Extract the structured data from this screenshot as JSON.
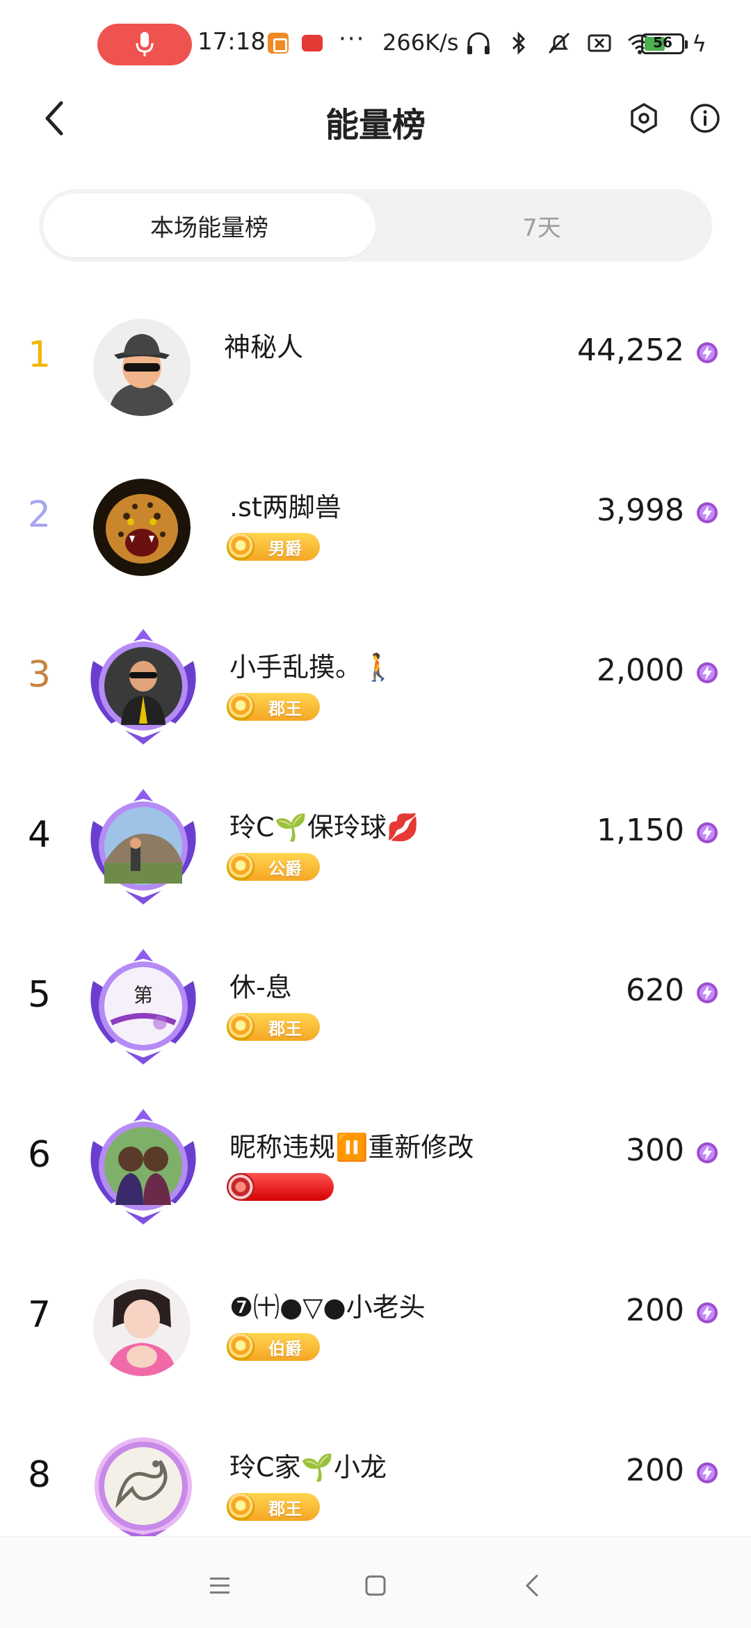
{
  "status_bar": {
    "time": "17:18",
    "dots": "···",
    "net_speed": "266K/s",
    "battery": "56",
    "charging": "ϟ"
  },
  "header": {
    "title": "能量榜"
  },
  "tabs": [
    {
      "label": "本场能量榜",
      "active": true
    },
    {
      "label": "7天",
      "active": false
    }
  ],
  "rankings": [
    {
      "rank": "1",
      "name": "神秘人",
      "badge": "",
      "score": "44,252"
    },
    {
      "rank": "2",
      "name": ".st两脚兽",
      "badge": "男爵",
      "score": "3,998"
    },
    {
      "rank": "3",
      "name": "小手乱摸。🚶",
      "badge": "郡王",
      "score": "2,000"
    },
    {
      "rank": "4",
      "name": "玲C🌱保玲球💋",
      "badge": "公爵",
      "score": "1,150"
    },
    {
      "rank": "5",
      "name": "休-息",
      "badge": "郡王",
      "score": "620"
    },
    {
      "rank": "6",
      "name": "昵称违规⏸️重新修改",
      "badge": "",
      "score": "300"
    },
    {
      "rank": "7",
      "name": "❼㈩●▽●小老头",
      "badge": "伯爵",
      "score": "200"
    },
    {
      "rank": "8",
      "name": "玲C家🌱小龙",
      "badge": "郡王",
      "score": "200"
    }
  ],
  "avatar_text": {
    "row5": "第"
  },
  "colors": {
    "rank1": "#f5b400",
    "rank2": "#a7a4f0",
    "rank3": "#c98242",
    "rank_default": "#111111",
    "energy_icon": "#9c4dcc",
    "badge_gold": "#f5a623",
    "mic_pill": "#ef5350"
  },
  "icons": {
    "back": "chevron-left-icon",
    "settings": "hexagon-settings-icon",
    "info": "info-icon",
    "energy": "lightning-gem-icon"
  }
}
